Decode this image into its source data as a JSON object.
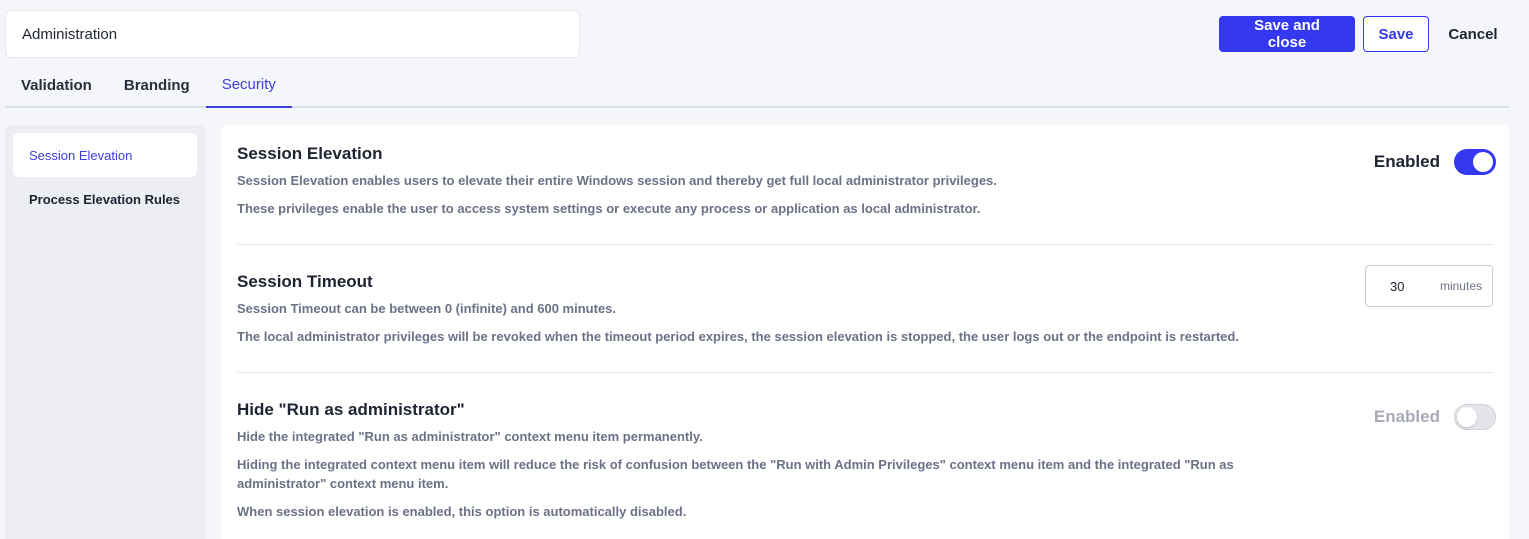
{
  "header": {
    "title": "Administration",
    "save_close_label": "Save and close",
    "save_label": "Save",
    "cancel_label": "Cancel"
  },
  "tabs": [
    {
      "label": "Validation"
    },
    {
      "label": "Branding"
    },
    {
      "label": "Security",
      "active": true
    }
  ],
  "sidebar": {
    "items": [
      {
        "label": "Session Elevation",
        "active": true
      },
      {
        "label": "Process Elevation Rules"
      }
    ]
  },
  "sections": {
    "session_elevation": {
      "title": "Session Elevation",
      "desc1": "Session Elevation enables users to elevate their entire Windows session and thereby get full local administrator privileges.",
      "desc2": "These privileges enable the user to access system settings or execute any process or application as local administrator.",
      "toggle_label": "Enabled",
      "toggle_on": true
    },
    "session_timeout": {
      "title": "Session Timeout",
      "desc1": "Session Timeout can be between 0 (infinite) and 600 minutes.",
      "desc2": "The local administrator privileges will be revoked when the timeout period expires, the session elevation is stopped, the user logs out or the endpoint is restarted.",
      "value": "30",
      "unit": "minutes"
    },
    "hide_run_as_admin": {
      "title": "Hide \"Run as administrator\"",
      "desc1": "Hide the integrated \"Run as administrator\" context menu item permanently.",
      "desc2": "Hiding the integrated context menu item will reduce the risk of confusion between the \"Run with Admin Privileges\" context menu item and the integrated \"Run as administrator\" context menu item.",
      "desc3": "When session elevation is enabled, this option is automatically disabled.",
      "toggle_label": "Enabled",
      "toggle_on": false,
      "disabled": true
    }
  },
  "colors": {
    "accent": "#3438f0",
    "background": "#f5f6fa",
    "text": "#1f2433",
    "muted": "#6b7287"
  }
}
